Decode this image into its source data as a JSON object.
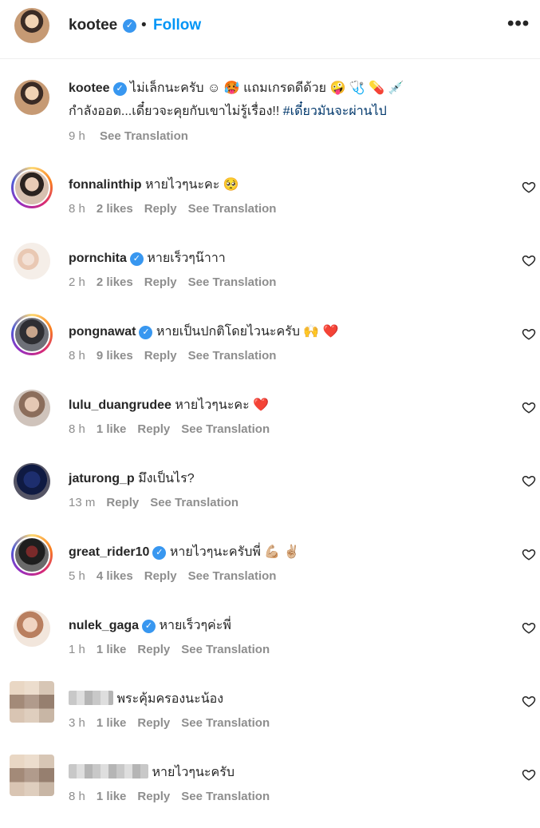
{
  "header": {
    "username": "kootee",
    "follow_label": "Follow",
    "more_label": "•••"
  },
  "post": {
    "username": "kootee",
    "caption_line1": "ไม่เล็กนะครับ ☺ 🥵 แถมเกรดดีด้วย 🤪 🩺 💊 💉",
    "caption_line2": "กำลังออต...เดี๋ยวจะคุยกับเขาไม่รู้เรื่อง!! ",
    "hashtag": "#เดี๋ยวมันจะผ่านไป",
    "time": "9 h",
    "see_translation": "See Translation"
  },
  "comments": [
    {
      "username": "fonnalinthip",
      "text": "หายไวๆนะคะ 🥺",
      "time": "8 h",
      "likes": "2 likes",
      "reply": "Reply",
      "see_translation": "See Translation"
    },
    {
      "username": "pornchita",
      "text": "หายเร็วๆน๊าาา",
      "time": "2 h",
      "likes": "2 likes",
      "reply": "Reply",
      "see_translation": "See Translation"
    },
    {
      "username": "pongnawat",
      "text": "หายเป็นปกติโดยไวนะครับ 🙌 ❤️",
      "time": "8 h",
      "likes": "9 likes",
      "reply": "Reply",
      "see_translation": "See Translation"
    },
    {
      "username": "lulu_duangrudee",
      "text": "หายไวๆนะคะ ❤️",
      "time": "8 h",
      "likes": "1 like",
      "reply": "Reply",
      "see_translation": "See Translation"
    },
    {
      "username": "jaturong_p",
      "text": "มึงเป็นไร?",
      "time": "13 m",
      "likes": "",
      "reply": "Reply",
      "see_translation": "See Translation"
    },
    {
      "username": "great_rider10",
      "text": "หายไวๆนะครับพี่ 💪🏼 ✌🏼",
      "time": "5 h",
      "likes": "4 likes",
      "reply": "Reply",
      "see_translation": "See Translation"
    },
    {
      "username": "nulek_gaga",
      "text": "หายเร็วๆค่ะพี่",
      "time": "1 h",
      "likes": "1 like",
      "reply": "Reply",
      "see_translation": "See Translation"
    },
    {
      "username": "",
      "text": "พระคุ้มครองนะน้อง",
      "time": "3 h",
      "likes": "1 like",
      "reply": "Reply",
      "see_translation": "See Translation"
    },
    {
      "username": "",
      "text": "หายไวๆนะครับ",
      "time": "8 h",
      "likes": "1 like",
      "reply": "Reply",
      "see_translation": "See Translation"
    }
  ],
  "colors": {
    "accent": "#0095f6",
    "verified": "#3897f0",
    "meta_text": "#8e8e8e",
    "hashtag": "#00376b",
    "heart_red": "#ed4956"
  },
  "icons": {
    "verified": "verified-badge-icon",
    "heart": "heart-outline-icon",
    "more": "more-options-icon"
  }
}
